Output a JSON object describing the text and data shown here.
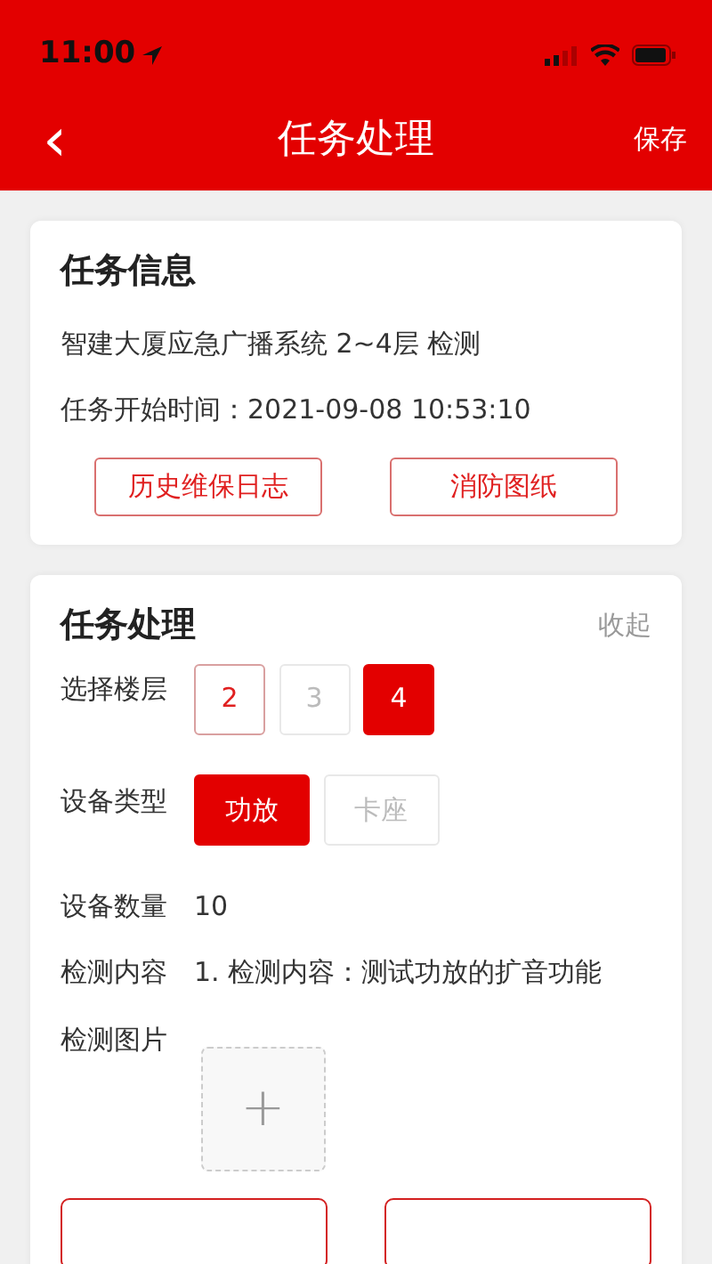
{
  "status_bar": {
    "time": "11:00"
  },
  "nav": {
    "back": "‹",
    "title": "任务处理",
    "action": "保存"
  },
  "info_card": {
    "title": "任务信息",
    "lines": [
      "智建大厦应急广播系统 2~4层 检测",
      "任务开始时间：2021-09-08 10:53:10"
    ],
    "buttons": [
      "历史维保日志",
      "消防图纸"
    ]
  },
  "process_card": {
    "title": "任务处理",
    "collapse": "收起",
    "floor": {
      "label": "选择楼层",
      "options": [
        {
          "label": "2",
          "selected": false,
          "disabled": false
        },
        {
          "label": "3",
          "selected": false,
          "disabled": true
        },
        {
          "label": "4",
          "selected": true,
          "disabled": false
        }
      ]
    },
    "device_type": {
      "label": "设备类型",
      "options": [
        {
          "label": "功放",
          "selected": true,
          "disabled": false
        },
        {
          "label": "卡座",
          "selected": false,
          "disabled": true
        }
      ]
    },
    "fields": [
      {
        "label": "设备数量",
        "value": "10"
      },
      {
        "label": "检测内容",
        "value": "1. 检测内容：测试功放的扩音功能"
      }
    ],
    "photo": {
      "label": "检测图片",
      "add": "+"
    },
    "bottom_buttons": [
      {
        "kind": "outline"
      },
      {
        "kind": "outline"
      }
    ]
  }
}
